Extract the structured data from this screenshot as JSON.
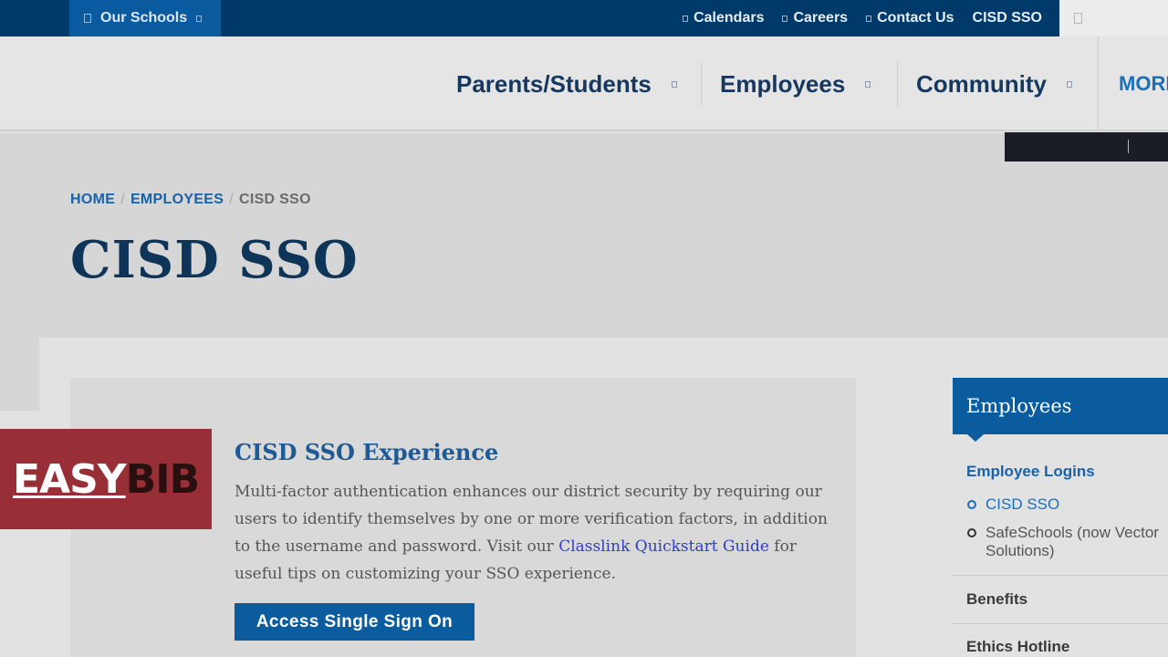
{
  "topbar": {
    "our_schools": "Our Schools",
    "links": [
      "Calendars",
      "Careers",
      "Contact Us",
      "CISD SSO"
    ]
  },
  "nav": {
    "items": [
      "Parents/Students",
      "Employees",
      "Community"
    ],
    "more": "MORE"
  },
  "breadcrumb": {
    "home": "HOME",
    "employees": "EMPLOYEES",
    "current": "CISD SSO",
    "separator": "/"
  },
  "page": {
    "title": "CISD SSO"
  },
  "content": {
    "heading": "CISD SSO Experience",
    "body_pre": "Multi-factor authentication enhances our district security by requiring our users to identify themselves by one or more verification factors, in addition to the username and password. Visit our ",
    "link_text": "Classlink Quickstart Guide",
    "body_post": " for useful tips on customizing your SSO experience.",
    "button": "Access Single Sign On"
  },
  "sidebar": {
    "header": "Employees",
    "group_title": "Employee Logins",
    "sub_items": [
      "CISD SSO",
      "SafeSchools (now Vector Solutions)"
    ],
    "items": [
      "Benefits",
      "Ethics Hotline"
    ]
  },
  "logo": {
    "easy": "EASY",
    "bib": "BIB"
  },
  "colors": {
    "topbar": "#003a6b",
    "accent": "#0a5c9f",
    "title": "#0e3458",
    "logo_bg": "#992f36"
  }
}
